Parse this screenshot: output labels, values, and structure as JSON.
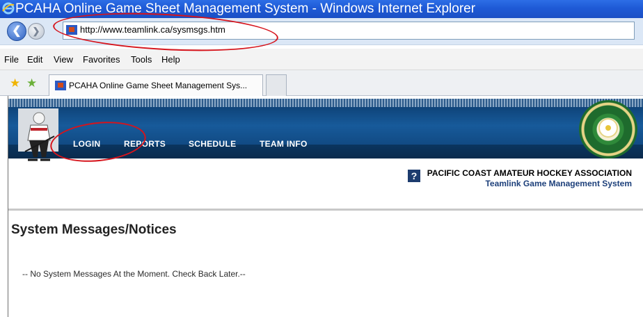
{
  "window": {
    "title": "PCAHA Online Game Sheet Management System - Windows Internet Explorer",
    "icon": "ie-icon"
  },
  "address_bar": {
    "url": "http://www.teamlink.ca/sysmsgs.htm"
  },
  "menu": {
    "items": [
      "File",
      "Edit",
      "View",
      "Favorites",
      "Tools",
      "Help"
    ]
  },
  "tabs": {
    "active_label": "PCAHA Online Game Sheet Management Sys..."
  },
  "site_nav": {
    "items": [
      "LOGIN",
      "REPORTS",
      "SCHEDULE",
      "TEAM INFO"
    ]
  },
  "header": {
    "help_glyph": "?",
    "association": "PACIFIC COAST AMATEUR HOCKEY ASSOCIATION",
    "system_name": "Teamlink Game Management System"
  },
  "main": {
    "title": "System Messages/Notices",
    "message": "-- No System Messages At the Moment. Check Back Later.--"
  },
  "colors": {
    "annotation": "#d6141c",
    "banner": "#175a9a",
    "system_name": "#1c3f7a"
  }
}
